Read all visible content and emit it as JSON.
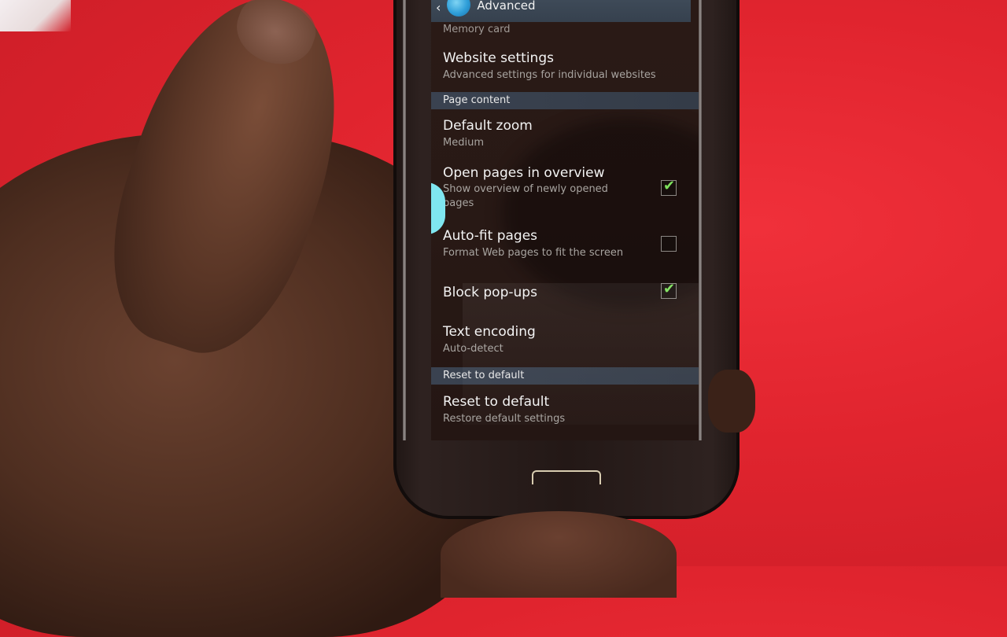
{
  "action_bar": {
    "back_icon": "chevron-left",
    "app_icon": "internet-globe-icon",
    "title": "Advanced"
  },
  "partial_item": {
    "subtitle": "Memory card"
  },
  "items": [
    {
      "id": "website-settings",
      "title": "Website settings",
      "subtitle": "Advanced settings for individual websites"
    },
    {
      "id": "default-zoom",
      "title": "Default zoom",
      "subtitle": "Medium"
    },
    {
      "id": "open-pages-overview",
      "title": "Open pages in overview",
      "subtitle": "Show overview of newly opened pages",
      "checked": true
    },
    {
      "id": "auto-fit-pages",
      "title": "Auto-fit pages",
      "subtitle": "Format Web pages to fit the screen",
      "checked": false
    },
    {
      "id": "block-popups",
      "title": "Block pop-ups",
      "checked": true
    },
    {
      "id": "text-encoding",
      "title": "Text encoding",
      "subtitle": "Auto-detect"
    },
    {
      "id": "reset-to-default",
      "title": "Reset to default",
      "subtitle": "Restore default settings"
    }
  ],
  "sections": {
    "page_content": "Page content",
    "reset": "Reset to default"
  },
  "icons": {
    "check": "✔",
    "back": "‹"
  },
  "colors": {
    "accent_check": "#7ee05c",
    "section_bg": "#3a4250",
    "background_red": "#e0242e"
  }
}
